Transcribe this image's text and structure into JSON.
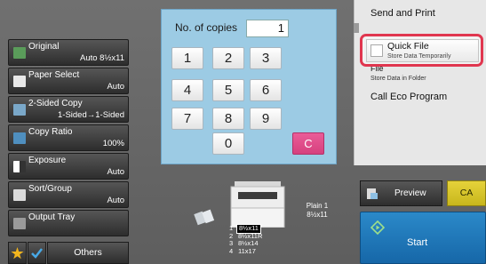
{
  "left_menu": [
    {
      "label": "Original",
      "value": "Auto   8½x11",
      "icon": "original-icon"
    },
    {
      "label": "Paper Select",
      "value": "Auto",
      "icon": "paper-select-icon"
    },
    {
      "label": "2-Sided Copy",
      "value": "1-Sided→1-Sided",
      "icon": "two-sided-copy-icon"
    },
    {
      "label": "Copy Ratio",
      "value": "100%",
      "icon": "copy-ratio-icon"
    },
    {
      "label": "Exposure",
      "value": "Auto",
      "icon": "exposure-icon"
    },
    {
      "label": "Sort/Group",
      "value": "Auto",
      "icon": "sort-group-icon"
    },
    {
      "label": "Output Tray",
      "value": "",
      "icon": "output-tray-icon"
    }
  ],
  "bottom_bar": {
    "star_icon": "star-icon",
    "check_icon": "checkmark-icon",
    "others_label": "Others"
  },
  "keypad": {
    "copies_label": "No. of copies",
    "copies_value": "1",
    "keys": [
      "1",
      "2",
      "3",
      "4",
      "5",
      "6",
      "7",
      "8",
      "9",
      "0"
    ],
    "clear_label": "C"
  },
  "preview": {
    "plain_label": "Plain 1",
    "plain_size": "8½x11",
    "trays": [
      {
        "num": "1",
        "size": "8½x11",
        "selected": true
      },
      {
        "num": "2",
        "size": "8½x11R",
        "selected": false
      },
      {
        "num": "3",
        "size": "8½x14",
        "selected": false
      },
      {
        "num": "4",
        "size": "11x17",
        "selected": false
      }
    ]
  },
  "right_panel": {
    "send_and_print": "Send and Print",
    "quick_file_label": "Quick File",
    "quick_file_sub": "Store Data Temporarily",
    "file_label": "File",
    "file_sub": "Store Data in Folder",
    "call_eco": "Call Eco Program"
  },
  "actions": {
    "preview_label": "Preview",
    "ca_label": "CA",
    "start_label": "Start"
  },
  "colors": {
    "keypad_bg": "#9ccbe4",
    "clear_key": "#d6407e",
    "highlight": "#e0364f",
    "ca_button": "#d4c22a",
    "start_button": "#1e78bb"
  }
}
